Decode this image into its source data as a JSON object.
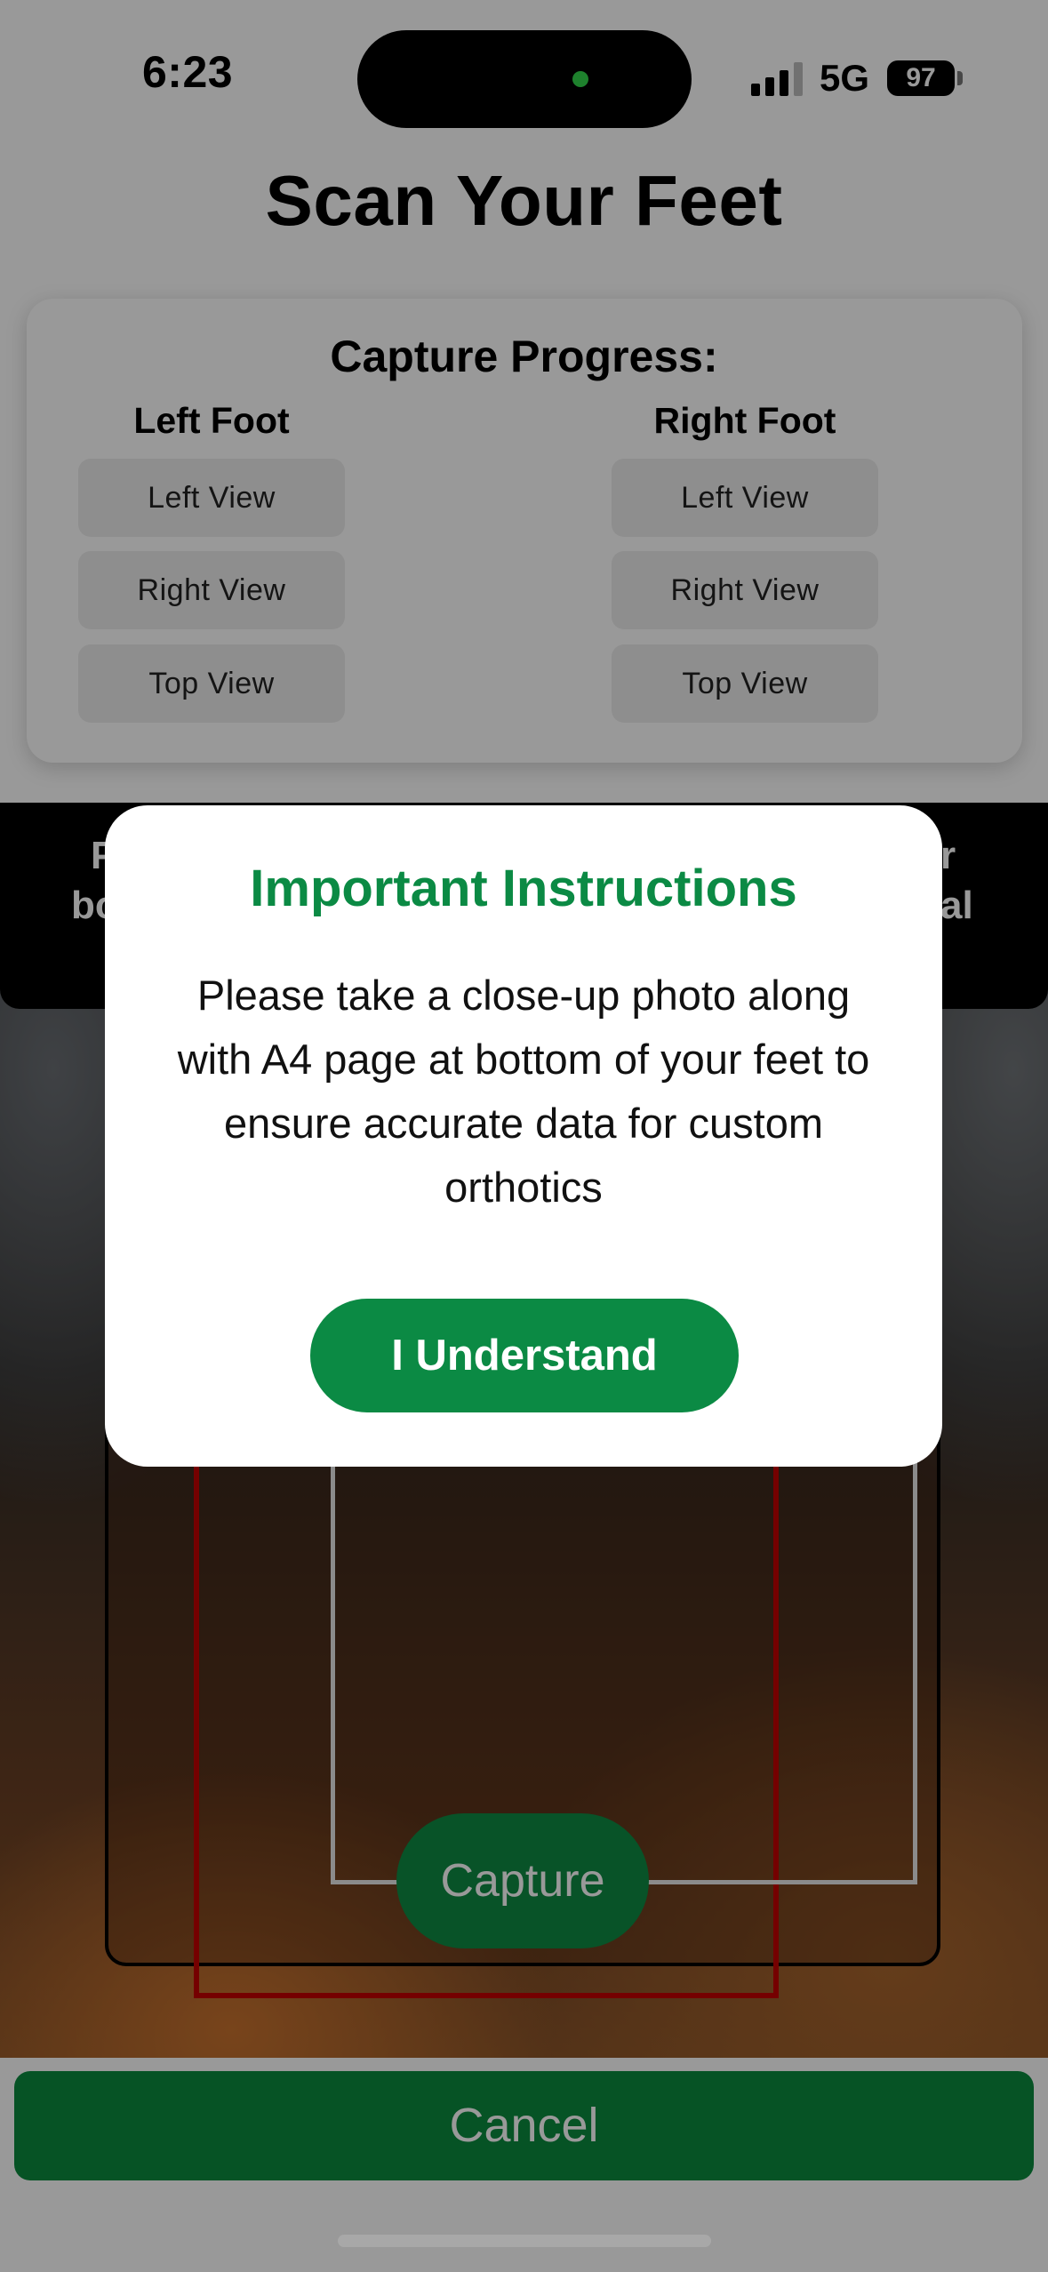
{
  "status_bar": {
    "time": "6:23",
    "network": "5G",
    "battery": "97"
  },
  "page": {
    "title": "Scan Your Feet"
  },
  "progress": {
    "title": "Capture Progress:",
    "left_foot": {
      "label": "Left Foot",
      "views": [
        "Left View",
        "Right View",
        "Top View"
      ]
    },
    "right_foot": {
      "label": "Right Foot",
      "views": [
        "Left View",
        "Right View",
        "Top View"
      ]
    }
  },
  "camera": {
    "banner_left_partial": [
      "P",
      "bo"
    ],
    "banner_right_partial": [
      "r",
      "al"
    ],
    "capture_label": "Capture"
  },
  "footer": {
    "cancel_label": "Cancel"
  },
  "modal": {
    "title": "Important Instructions",
    "body": "Please take a close-up photo along with A4 page at bottom of your feet to ensure accurate data for custom orthotics",
    "button_label": "I Understand"
  },
  "colors": {
    "brand_green": "#0b8a44",
    "frame_red": "#c40000"
  }
}
